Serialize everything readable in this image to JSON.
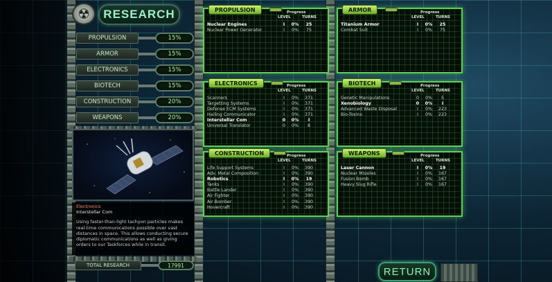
{
  "header": {
    "title": "RESEARCH",
    "logo_icon": "☢"
  },
  "categories": [
    {
      "label": "PROPULSION",
      "percent": "15%"
    },
    {
      "label": "ARMOR",
      "percent": "15%"
    },
    {
      "label": "ELECTRONICS",
      "percent": "15%"
    },
    {
      "label": "BIOTECH",
      "percent": "15%"
    },
    {
      "label": "CONSTRUCTION",
      "percent": "20%"
    },
    {
      "label": "WEAPONS",
      "percent": "20%"
    }
  ],
  "description": {
    "category": "Electronics",
    "name": "Interstellar Com",
    "text": "Using faster-than-light tachyon particles makes real-time communications possible over vast distances in space. This allows conducting secure diplomatic communications as well as giving orders to our Taskforces while in transit."
  },
  "total": {
    "label": "TOTAL RESEARCH",
    "value": "17991"
  },
  "column_headers": {
    "progress": "Progress",
    "level": "LEVEL",
    "turns": "TURNS"
  },
  "panels": {
    "propulsion": {
      "title": "PROPULSION",
      "techs": [
        {
          "name": "Nuclear Engines",
          "level": "I",
          "progress": "0%",
          "turns": "25",
          "bold": true
        },
        {
          "name": "Nuclear Power Generator",
          "level": "I",
          "progress": "0%",
          "turns": "75",
          "bold": false
        }
      ]
    },
    "armor": {
      "title": "ARMOR",
      "techs": [
        {
          "name": "Titanium Armor",
          "level": "I",
          "progress": "0%",
          "turns": "25",
          "bold": true
        },
        {
          "name": "Combat Suit",
          "level": "I",
          "progress": "0%",
          "turns": "75",
          "bold": false
        }
      ]
    },
    "electronics": {
      "title": "ELECTRONICS",
      "techs": [
        {
          "name": "Scanners",
          "level": "I",
          "progress": "0%",
          "turns": "371",
          "bold": false
        },
        {
          "name": "Targetting Systems",
          "level": "I",
          "progress": "0%",
          "turns": "371",
          "bold": false
        },
        {
          "name": "Defense ECM Systems",
          "level": "I",
          "progress": "0%",
          "turns": "371",
          "bold": false
        },
        {
          "name": "Hailing Communicator",
          "level": "I",
          "progress": "0%",
          "turns": "371",
          "bold": false
        },
        {
          "name": "Interstellar Com",
          "level": "0",
          "progress": "0%",
          "turns": "I",
          "bold": true
        },
        {
          "name": "Universal Translator",
          "level": "0",
          "progress": "0%",
          "turns": "8",
          "bold": false
        }
      ]
    },
    "biotech": {
      "title": "BIOTECH",
      "techs": [
        {
          "name": "Genetic Manipulations",
          "level": "0",
          "progress": "0%",
          "turns": "5",
          "bold": false
        },
        {
          "name": "Xenobiology",
          "level": "0",
          "progress": "0%",
          "turns": "I",
          "bold": true
        },
        {
          "name": "Advanced Waste Disposal",
          "level": "I",
          "progress": "0%",
          "turns": "223",
          "bold": false
        },
        {
          "name": "Bio-Toxins",
          "level": "I",
          "progress": "0%",
          "turns": "223",
          "bold": false
        }
      ]
    },
    "construction": {
      "title": "CONSTRUCTION",
      "techs": [
        {
          "name": "Life Support Systems",
          "level": "I",
          "progress": "0%",
          "turns": "390",
          "bold": false
        },
        {
          "name": "Adv. Metal Composition",
          "level": "I",
          "progress": "0%",
          "turns": "390",
          "bold": false
        },
        {
          "name": "Robotics",
          "level": "I",
          "progress": "0%",
          "turns": "19",
          "bold": true
        },
        {
          "name": "Tanks",
          "level": "I",
          "progress": "0%",
          "turns": "390",
          "bold": false
        },
        {
          "name": "Battle Lander",
          "level": "I",
          "progress": "0%",
          "turns": "390",
          "bold": false
        },
        {
          "name": "Air Fighter",
          "level": "I",
          "progress": "0%",
          "turns": "390",
          "bold": false
        },
        {
          "name": "Air Bomber",
          "level": "I",
          "progress": "0%",
          "turns": "390",
          "bold": false
        },
        {
          "name": "Hovercraft",
          "level": "I",
          "progress": "0%",
          "turns": "390",
          "bold": false
        }
      ]
    },
    "weapons": {
      "title": "WEAPONS",
      "techs": [
        {
          "name": "Laser Cannon",
          "level": "I",
          "progress": "0%",
          "turns": "19",
          "bold": true
        },
        {
          "name": "Nuclear Missiles",
          "level": "I",
          "progress": "0%",
          "turns": "167",
          "bold": false
        },
        {
          "name": "Fusion Bomb",
          "level": "I",
          "progress": "0%",
          "turns": "167",
          "bold": false
        },
        {
          "name": "Heavy Slug Rifle",
          "level": "I",
          "progress": "0%",
          "turns": "167",
          "bold": false
        }
      ]
    }
  },
  "return_label": "RETURN",
  "colors": {
    "panel_border": "#5fcf55",
    "accent_text": "#9ef0c0",
    "desc_category": "#ff8c66"
  }
}
